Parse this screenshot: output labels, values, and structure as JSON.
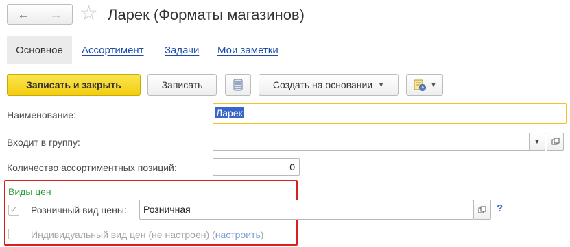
{
  "nav": {
    "back_icon": "←",
    "forward_icon": "→"
  },
  "header": {
    "star_icon": "☆",
    "title": "Ларек (Форматы магазинов)"
  },
  "tabs": [
    {
      "label": "Основное"
    },
    {
      "label": "Ассортимент"
    },
    {
      "label": "Задачи"
    },
    {
      "label": "Мои заметки"
    }
  ],
  "toolbar": {
    "save_close_label": "Записать и закрыть",
    "save_label": "Записать",
    "list_icon": "list-icon",
    "create_based_label": "Создать на основании",
    "caret": "▼",
    "report_icon": "report-icon"
  },
  "form": {
    "name_label": "Наименование:",
    "name_value": "Ларек",
    "group_label": "Входит в группу:",
    "group_value": "",
    "count_label": "Количество ассортиментных позиций:",
    "count_value": "0"
  },
  "prices": {
    "section_title": "Виды цен",
    "retail_label": "Розничный вид цены:",
    "retail_value": "Розничная",
    "help": "?",
    "individual_label": "Индивидуальный вид цен (не настроен) (",
    "individual_link": "настроить",
    "individual_close": ")",
    "check_mark": "✓"
  },
  "colors": {
    "accent": "#f2cd0f",
    "link": "#1f4eaa",
    "section": "#2b9a3a",
    "highlight_box": "#d8201e"
  }
}
